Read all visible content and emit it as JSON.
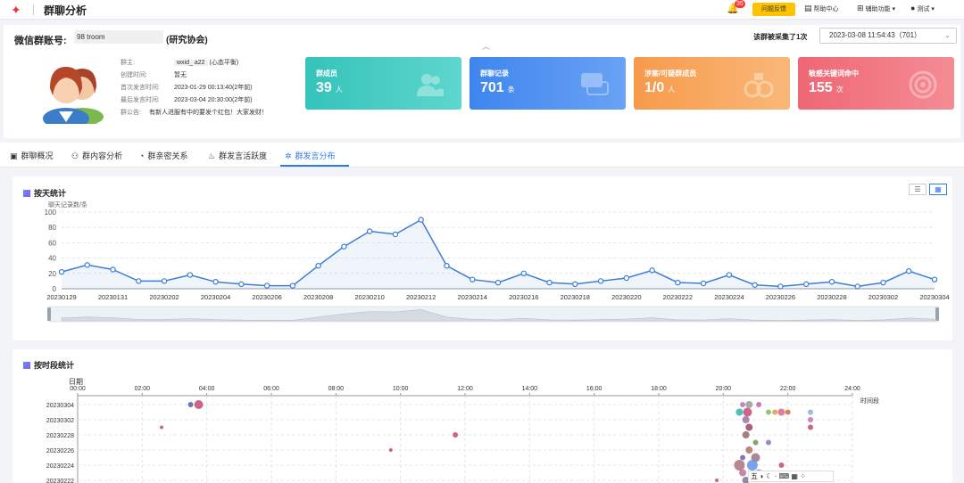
{
  "app": {
    "title": "群聊分析"
  },
  "topbar": {
    "bell_count": "35",
    "feedback_label": "问题反馈",
    "help_label": "帮助中心",
    "tools_label": "辅助功能",
    "user_label": "测试"
  },
  "group": {
    "account_label": "微信群账号:",
    "account_value": "98            troom",
    "account_org": "(研究协会)",
    "collect_label": "该群被采集了1次",
    "collect_value": "2023-03-08 11:54:43（701）",
    "owner_key": "群主:",
    "owner_value": "wxid_            a22",
    "owner_suffix": "(心态平衡)",
    "created_key": "创建时间:",
    "created_value": "暂无",
    "first_key": "首次发言时间:",
    "first_value": "2023-01-29 00:13:40(2年前)",
    "last_key": "最后发言时间:",
    "last_value": "2023-03-04 20:30:00(2年前)",
    "notice_key": "群公告:",
    "notice_value": "有新人进服有中的要发个红包！大家发财！"
  },
  "stats": [
    {
      "label": "群成员",
      "value": "39",
      "unit": "人",
      "color": "#3cc9c1"
    },
    {
      "label": "群聊记录",
      "value": "701",
      "unit": "条",
      "color": "#4b8ff3"
    },
    {
      "label": "涉案/可疑群成员",
      "value": "1/0",
      "unit": "人",
      "color": "#f8a45a"
    },
    {
      "label": "敏感关键词命中",
      "value": "155",
      "unit": "次",
      "color": "#f0717b"
    }
  ],
  "tabs": [
    {
      "label": "群聊概况",
      "icon": "clipboard-icon"
    },
    {
      "label": "群内容分析",
      "icon": "network-icon"
    },
    {
      "label": "群亲密关系",
      "icon": "pie-icon"
    },
    {
      "label": "群发言活跃度",
      "icon": "flame-icon"
    },
    {
      "label": "群发言分布",
      "icon": "scatter-icon",
      "active": true
    }
  ],
  "chart_data": [
    {
      "type": "line",
      "title": "按天统计",
      "ylabel": "聊天记录数/条",
      "ylim": [
        0,
        100
      ],
      "yticks": [
        0,
        20,
        40,
        60,
        80,
        100
      ],
      "x": [
        "20230129",
        "20230130",
        "20230131",
        "20230201",
        "20230202",
        "20230203",
        "20230204",
        "20230205",
        "20230206",
        "20230207",
        "20230208",
        "20230209",
        "20230210",
        "20230211",
        "20230212",
        "20230213",
        "20230214",
        "20230215",
        "20230216",
        "20230217",
        "20230218",
        "20230219",
        "20230220",
        "20230221",
        "20230222",
        "20230223",
        "20230224",
        "20230225",
        "20230226",
        "20230227",
        "20230228",
        "20230301",
        "20230302",
        "20230303",
        "20230304"
      ],
      "xticks": [
        "20230129",
        "20230131",
        "20230202",
        "20230204",
        "20230206",
        "20230208",
        "20230210",
        "20230212",
        "20230214",
        "20230216",
        "20230218",
        "20230220",
        "20230222",
        "20230224",
        "20230226",
        "20230228",
        "20230302",
        "20230304"
      ],
      "values": [
        22,
        31,
        25,
        10,
        10,
        18,
        9,
        6,
        4,
        4,
        30,
        55,
        75,
        71,
        90,
        30,
        12,
        8,
        20,
        8,
        6,
        10,
        14,
        24,
        8,
        7,
        18,
        5,
        3,
        6,
        9,
        3,
        8,
        23,
        12
      ],
      "color": "#3d7dd8",
      "grid": true
    },
    {
      "type": "scatter",
      "title": "按时段统计",
      "ylabel": "日期",
      "xlabel": "时间段",
      "xticks": [
        "00:00",
        "02:00",
        "04:00",
        "06:00",
        "08:00",
        "10:00",
        "12:00",
        "14:00",
        "16:00",
        "18:00",
        "20:00",
        "22:00",
        "24:00"
      ],
      "yticks": [
        "20230304",
        "20230302",
        "20230228",
        "20230226",
        "20230224",
        "20230222"
      ],
      "points": [
        {
          "date": "20230304",
          "hour": 3.5,
          "size": 3,
          "color": "#5a6aa8"
        },
        {
          "date": "20230304",
          "hour": 3.75,
          "size": 5,
          "color": "#c9537d"
        },
        {
          "date": "20230304",
          "hour": 20.6,
          "size": 3,
          "color": "#b77fb0"
        },
        {
          "date": "20230304",
          "hour": 20.8,
          "size": 4,
          "color": "#a0a0a0"
        },
        {
          "date": "20230304",
          "hour": 21.1,
          "size": 3,
          "color": "#c86bb4"
        },
        {
          "date": "20230303",
          "hour": 20.5,
          "size": 4,
          "color": "#3bb9b1"
        },
        {
          "date": "20230303",
          "hour": 20.75,
          "size": 5,
          "color": "#c9537d"
        },
        {
          "date": "20230303",
          "hour": 21.4,
          "size": 3,
          "color": "#7dc36b"
        },
        {
          "date": "20230303",
          "hour": 21.6,
          "size": 3,
          "color": "#e0a04f"
        },
        {
          "date": "20230303",
          "hour": 21.8,
          "size": 4,
          "color": "#e06f8e"
        },
        {
          "date": "20230303",
          "hour": 22.0,
          "size": 3,
          "color": "#c67a50"
        },
        {
          "date": "20230303",
          "hour": 22.7,
          "size": 3,
          "color": "#9ab0d8"
        },
        {
          "date": "20230302",
          "hour": 20.7,
          "size": 4,
          "color": "#a07aa8"
        },
        {
          "date": "20230302",
          "hour": 22.7,
          "size": 3,
          "color": "#c07ab8"
        },
        {
          "date": "20230301",
          "hour": 2.6,
          "size": 2,
          "color": "#c9537d"
        },
        {
          "date": "20230301",
          "hour": 20.8,
          "size": 4,
          "color": "#a05070"
        },
        {
          "date": "20230301",
          "hour": 22.7,
          "size": 3,
          "color": "#c9537d"
        },
        {
          "date": "20230228",
          "hour": 11.7,
          "size": 3,
          "color": "#c9537d"
        },
        {
          "date": "20230228",
          "hour": 20.7,
          "size": 4,
          "color": "#9a6f7a"
        },
        {
          "date": "20230227",
          "hour": 21.0,
          "size": 3,
          "color": "#7a9a5a"
        },
        {
          "date": "20230227",
          "hour": 21.4,
          "size": 3,
          "color": "#8a7fc8"
        },
        {
          "date": "20230226",
          "hour": 9.7,
          "size": 2,
          "color": "#c9537d"
        },
        {
          "date": "20230226",
          "hour": 20.8,
          "size": 4,
          "color": "#b77a70"
        },
        {
          "date": "20230225",
          "hour": 20.6,
          "size": 3,
          "color": "#7a6aa0"
        },
        {
          "date": "20230225",
          "hour": 21.0,
          "size": 5,
          "color": "#a07a8a"
        },
        {
          "date": "20230224",
          "hour": 20.5,
          "size": 6,
          "color": "#b07a8a"
        },
        {
          "date": "20230224",
          "hour": 20.9,
          "size": 6,
          "color": "#6a9ae8"
        },
        {
          "date": "20230224",
          "hour": 21.8,
          "size": 3,
          "color": "#c9537d"
        },
        {
          "date": "20230223",
          "hour": 20.6,
          "size": 4,
          "color": "#c07aa0"
        },
        {
          "date": "20230223",
          "hour": 21.1,
          "size": 4,
          "color": "#a0a0c0"
        },
        {
          "date": "20230222",
          "hour": 20.7,
          "size": 4,
          "color": "#8a7aa0"
        },
        {
          "date": "20230222",
          "hour": 19.8,
          "size": 2,
          "color": "#c9537d"
        }
      ]
    }
  ],
  "ime_bar": {
    "label": "五"
  }
}
